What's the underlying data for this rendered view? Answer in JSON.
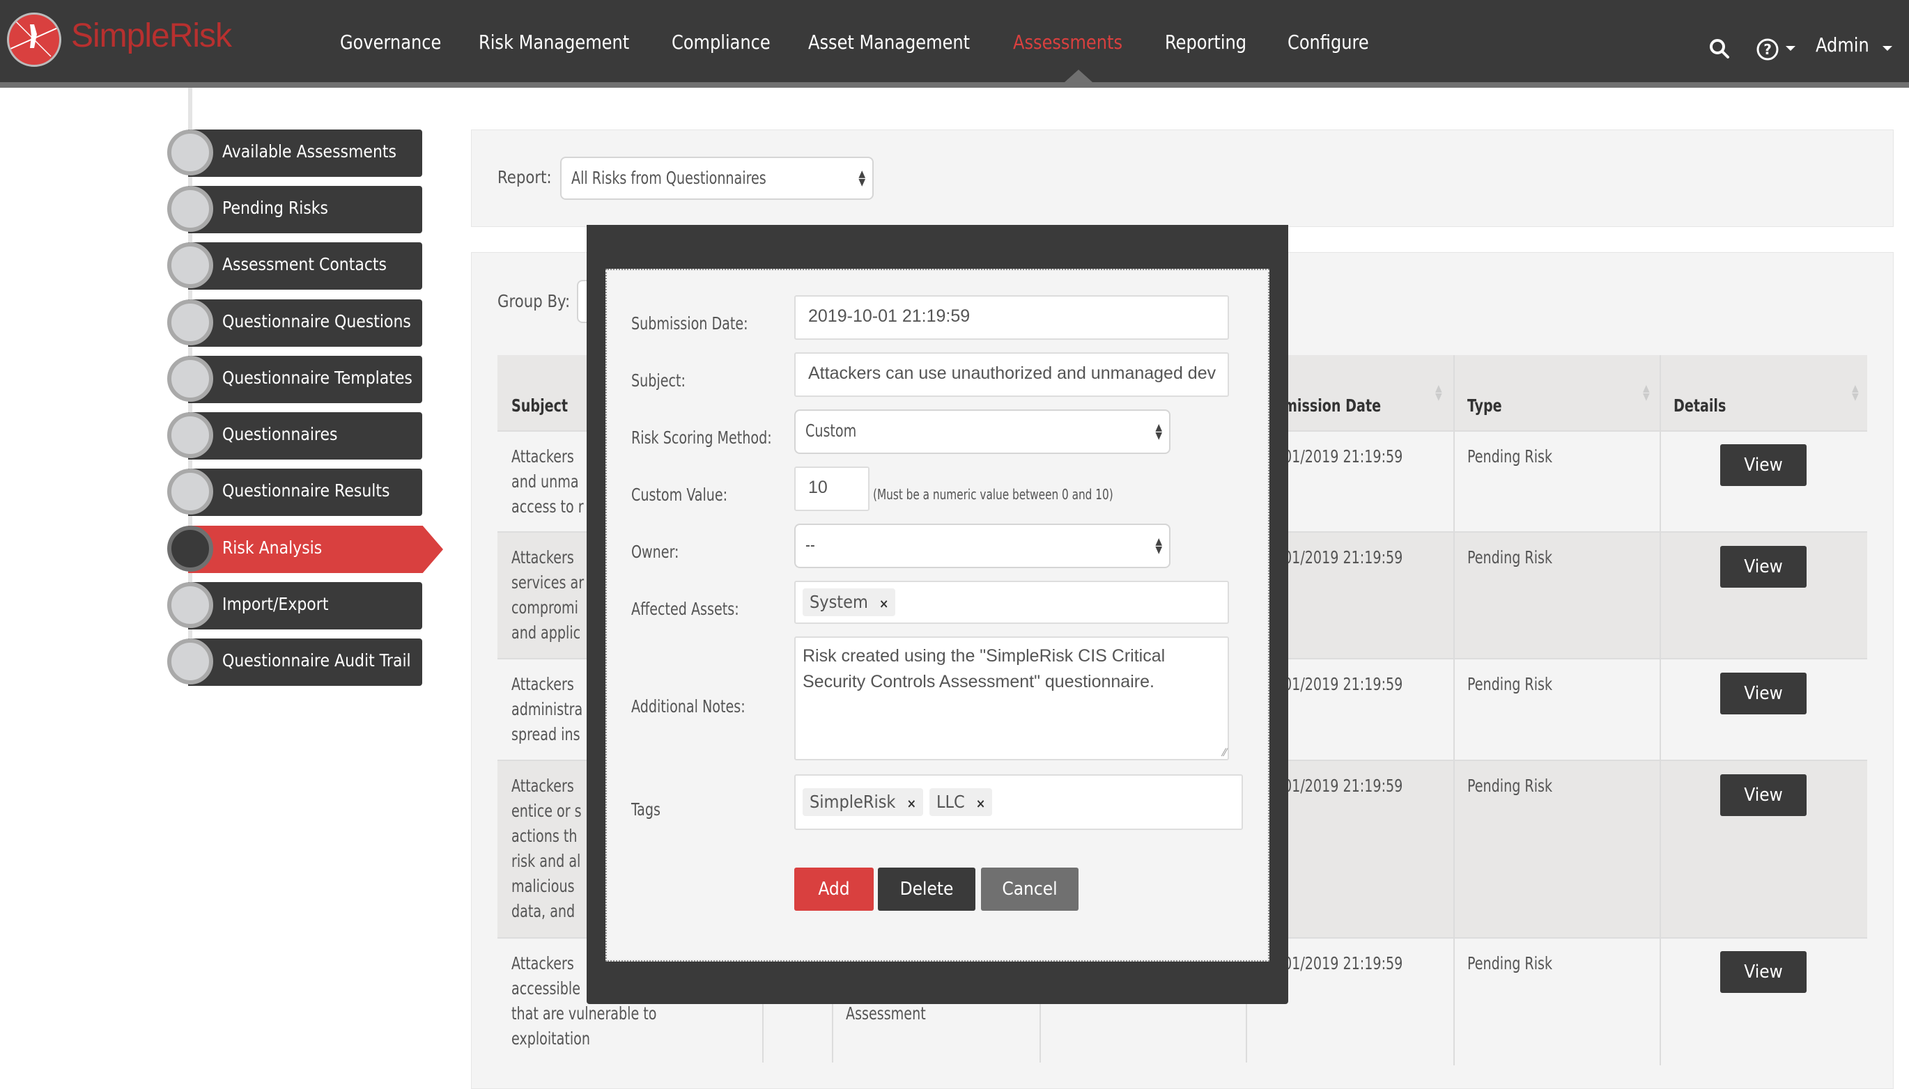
{
  "brand": {
    "name": "SimpleRisk"
  },
  "nav": {
    "items": [
      {
        "label": "Governance",
        "active": false
      },
      {
        "label": "Risk Management",
        "active": false
      },
      {
        "label": "Compliance",
        "active": false
      },
      {
        "label": "Asset Management",
        "active": false
      },
      {
        "label": "Assessments",
        "active": true
      },
      {
        "label": "Reporting",
        "active": false
      },
      {
        "label": "Configure",
        "active": false
      }
    ],
    "search_icon": "search-icon",
    "help_icon": "help-circle-icon",
    "user": "Admin"
  },
  "sidebar": {
    "items": [
      {
        "label": "Available Assessments"
      },
      {
        "label": "Pending Risks"
      },
      {
        "label": "Assessment Contacts"
      },
      {
        "label": "Questionnaire Questions"
      },
      {
        "label": "Questionnaire Templates"
      },
      {
        "label": "Questionnaires"
      },
      {
        "label": "Questionnaire Results"
      },
      {
        "label": "Risk Analysis",
        "active": true
      },
      {
        "label": "Import/Export"
      },
      {
        "label": "Questionnaire Audit Trail"
      }
    ]
  },
  "report": {
    "label": "Report:",
    "selected": "All Risks from Questionnaires"
  },
  "group": {
    "label": "Group By:"
  },
  "table": {
    "headers": {
      "subject": "Subject",
      "submission_date": "mission Date",
      "type": "Type",
      "details": "Details"
    },
    "rows": [
      {
        "subject": [
          "Attackers",
          "and unma",
          "access to r"
        ],
        "date": "01/2019 21:19:59",
        "type": "Pending Risk",
        "action": "View"
      },
      {
        "subject": [
          "Attackers",
          "services ar",
          "compromi",
          "and applic"
        ],
        "date": "01/2019 21:19:59",
        "type": "Pending Risk",
        "action": "View"
      },
      {
        "subject": [
          "Attackers",
          "administra",
          "spread ins"
        ],
        "date": "01/2019 21:19:59",
        "type": "Pending Risk",
        "action": "View"
      },
      {
        "subject": [
          "Attackers",
          "entice or s",
          "actions th",
          "risk and al",
          "malicious",
          "data, and"
        ],
        "date": "01/2019 21:19:59",
        "type": "Pending Risk",
        "action": "View"
      },
      {
        "subject": [
          "Attackers",
          "accessible",
          "that are vulnerable to",
          "exploitation"
        ],
        "extra": "Assessment",
        "date": "01/2019 21:19:59",
        "type": "Pending Risk",
        "action": "View"
      }
    ]
  },
  "modal": {
    "submission_date": {
      "label": "Submission Date:",
      "value": "2019-10-01 21:19:59"
    },
    "subject": {
      "label": "Subject:",
      "value": "Attackers can use unauthorized and unmanaged dev"
    },
    "scoring": {
      "label": "Risk Scoring Method:",
      "value": "Custom"
    },
    "custom_value": {
      "label": "Custom Value:",
      "value": "10",
      "hint": "(Must be a numeric value between 0 and 10)"
    },
    "owner": {
      "label": "Owner:",
      "value": "--"
    },
    "assets": {
      "label": "Affected Assets:",
      "chips": [
        "System"
      ]
    },
    "notes": {
      "label": "Additional Notes:",
      "value": "Risk created using the \"SimpleRisk CIS Critical Security Controls Assessment\" questionnaire."
    },
    "tags": {
      "label": "Tags",
      "chips": [
        "SimpleRisk",
        "LLC"
      ]
    },
    "buttons": {
      "add": "Add",
      "delete": "Delete",
      "cancel": "Cancel"
    }
  },
  "colors": {
    "accent": "#d9403f",
    "dark": "#3a3a3a",
    "gray_button": "#707070"
  }
}
